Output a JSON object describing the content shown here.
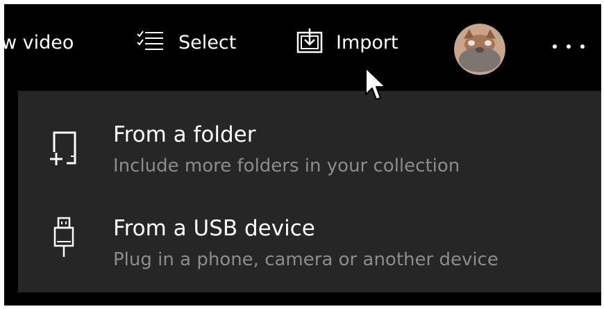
{
  "toolbar": {
    "new_video_label": "w video",
    "select_label": "Select",
    "import_label": "Import",
    "avatar_icon": "user-avatar",
    "more_icon": "ellipsis-icon"
  },
  "import_menu": {
    "items": [
      {
        "title": "From a folder",
        "subtitle": "Include more folders in your collection",
        "icon": "add-folder-icon"
      },
      {
        "title": "From a USB device",
        "subtitle": "Plug in a phone, camera or another device",
        "icon": "usb-icon"
      }
    ]
  },
  "colors": {
    "toolbar_bg": "#000000",
    "flyout_bg": "#262626",
    "primary_text": "#ffffff",
    "secondary_text": "#8c8c8c"
  }
}
